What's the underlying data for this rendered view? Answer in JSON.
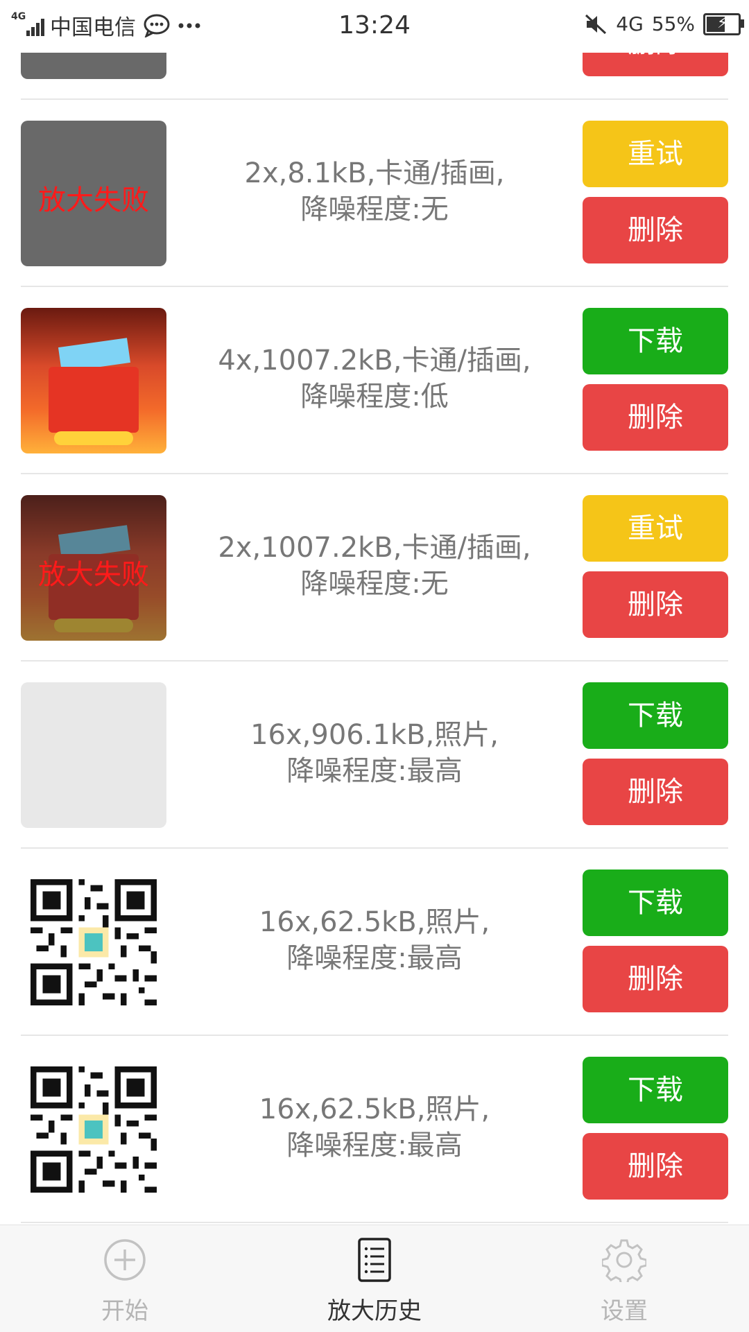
{
  "status_bar": {
    "network_tag": "4G",
    "carrier": "中国电信",
    "time": "13:24",
    "network": "4G",
    "battery": "55%"
  },
  "colors": {
    "retry": "#f5c518",
    "download": "#19ad19",
    "delete": "#e84545",
    "fail_text": "#ff1a1a"
  },
  "history": [
    {
      "thumbnail": "gray-failed",
      "overlay": "放大失败",
      "line1": "2x,8.1kB,卡通/插画,",
      "line2": "降噪程度:无",
      "primary_button": "重试",
      "delete_button": "删除"
    },
    {
      "thumbnail": "promo-image",
      "overlay": "",
      "line1": "4x,1007.2kB,卡通/插画,",
      "line2": "降噪程度:低",
      "primary_button": "下载",
      "delete_button": "删除"
    },
    {
      "thumbnail": "promo-image-failed",
      "overlay": "放大失败",
      "line1": "2x,1007.2kB,卡通/插画,",
      "line2": "降噪程度:无",
      "primary_button": "重试",
      "delete_button": "删除"
    },
    {
      "thumbnail": "blank",
      "overlay": "",
      "line1": "16x,906.1kB,照片,",
      "line2": "降噪程度:最高",
      "primary_button": "下载",
      "delete_button": "删除"
    },
    {
      "thumbnail": "qr-code",
      "overlay": "",
      "line1": "16x,62.5kB,照片,",
      "line2": "降噪程度:最高",
      "primary_button": "下载",
      "delete_button": "删除"
    },
    {
      "thumbnail": "qr-code",
      "overlay": "",
      "line1": "16x,62.5kB,照片,",
      "line2": "降噪程度:最高",
      "primary_button": "下载",
      "delete_button": "删除"
    }
  ],
  "partial_top_button": "删除",
  "bottom_nav": {
    "start": {
      "label": "开始",
      "icon": "plus-circle-icon"
    },
    "history": {
      "label": "放大历史",
      "icon": "list-document-icon",
      "active": true
    },
    "settings": {
      "label": "设置",
      "icon": "gear-icon"
    }
  }
}
